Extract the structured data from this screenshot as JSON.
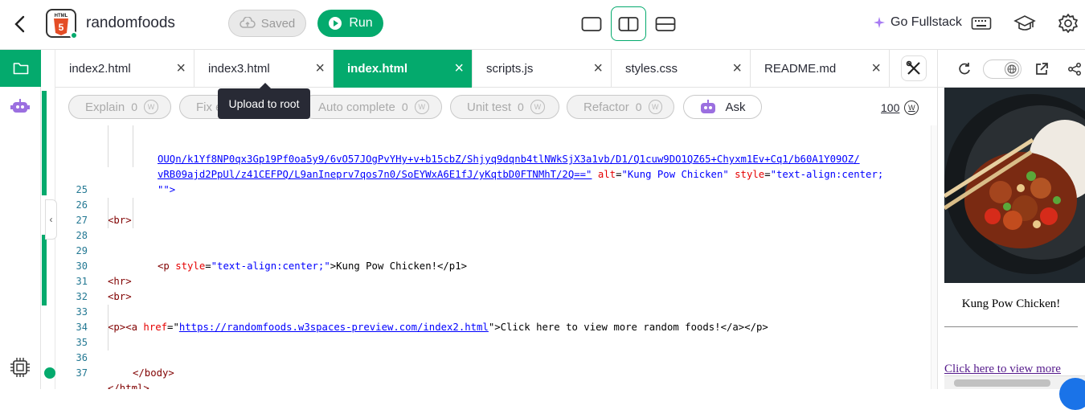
{
  "header": {
    "project_name": "randomfoods",
    "logo_text": "HTML",
    "saved_label": "Saved",
    "run_label": "Run",
    "go_fullstack_label": "Go Fullstack"
  },
  "tabs": [
    {
      "label": "index2.html",
      "active": false
    },
    {
      "label": "index3.html",
      "active": false
    },
    {
      "label": "index.html",
      "active": true
    },
    {
      "label": "scripts.js",
      "active": false
    },
    {
      "label": "styles.css",
      "active": false
    },
    {
      "label": "README.md",
      "active": false
    }
  ],
  "tooltip": "Upload to root",
  "ai_bar": {
    "explain": {
      "label": "Explain",
      "count": "0"
    },
    "fix": {
      "label": "Fix e",
      "count": ""
    },
    "autocomplete": {
      "label": "Auto complete",
      "count": "0"
    },
    "unittest": {
      "label": "Unit test",
      "count": "0"
    },
    "refactor": {
      "label": "Refactor",
      "count": "0"
    },
    "ask": {
      "label": "Ask"
    },
    "credits": "100"
  },
  "code": {
    "wrap1": "OUQn/k1Yf8NP0qx3Gp19Pf0oa5y9/6vO57JOgPvYHy+v+b15cbZ/Shjyq9dqnb4tlNWkSjX3a1vb/D1/Q1cuw9DO1QZ65+Chyxm1Ev+Cq1/b60A1Y09OZ/",
    "wrap2_url": "vRB09ajd2PpUl/z41CEFPQ/L9anIneprv7qos7n0/SoEYWxA6E1fJ/yKqtbD0FTNMhT/2Q==\"",
    "wrap2_alt_attr": "alt",
    "wrap2_alt_val": "\"Kung Pow Chicken\"",
    "wrap2_style_attr": "style",
    "wrap2_style_val": "\"text-align:center;",
    "wrap3": "\"\">",
    "lines": [
      {
        "n": "25",
        "text": ""
      },
      {
        "n": "26",
        "text": "<br>"
      },
      {
        "n": "27",
        "text": ""
      },
      {
        "n": "28",
        "p_open": "<p ",
        "p_attr": "style",
        "p_val": "\"text-align:center;\"",
        "p_rest": ">Kung Pow Chicken!</p1>"
      },
      {
        "n": "29",
        "text": ""
      },
      {
        "n": "30",
        "text": "<hr>"
      },
      {
        "n": "31",
        "text": "<br>"
      },
      {
        "n": "32",
        "text": ""
      },
      {
        "n": "33",
        "a_open": "<p><a ",
        "a_attr": "href",
        "a_url": "https://randomfoods.w3spaces-preview.com/index2.html",
        "a_rest": "Click here to view more random foods!</a></p>"
      },
      {
        "n": "34",
        "text": ""
      },
      {
        "n": "35",
        "text": "</body>"
      },
      {
        "n": "36",
        "text": ""
      },
      {
        "n": "37",
        "text": "</html>"
      }
    ]
  },
  "preview": {
    "caption": "Kung Pow Chicken!",
    "link_text": "Click here to view more"
  },
  "colors": {
    "brand_green": "#04aa6d",
    "dark": "#282a35"
  }
}
